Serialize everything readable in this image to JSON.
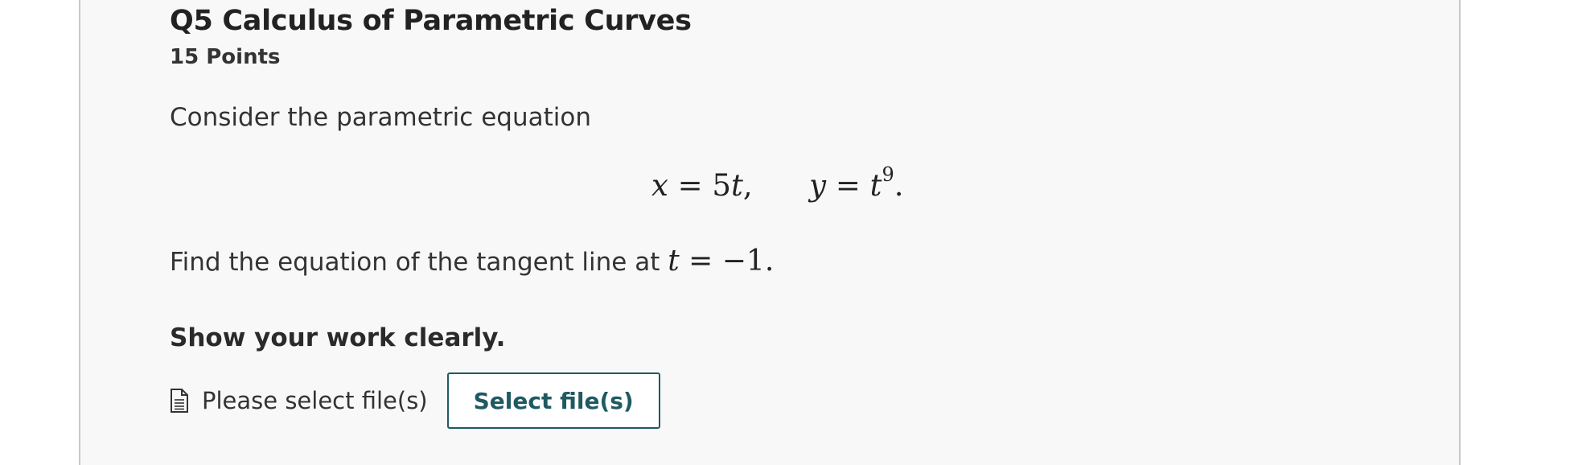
{
  "question": {
    "title": "Q5 Calculus of Parametric Curves",
    "points": "15 Points",
    "intro": "Consider the parametric equation",
    "equation": {
      "x_lhs": "x",
      "x_rhs_coef": "5",
      "x_rhs_var": "t",
      "y_lhs": "y",
      "y_rhs_base": "t",
      "y_rhs_exp": "9"
    },
    "find_text": "Find the equation of the tangent line at ",
    "find_math_var": "t",
    "find_math_value": "−1",
    "instruction": "Show your work clearly."
  },
  "upload": {
    "icon": "file-document-icon",
    "label": "Please select file(s)",
    "button_label": "Select file(s)"
  },
  "colors": {
    "panel_bg": "#f8f8f8",
    "button_accent": "#1f5a63"
  }
}
